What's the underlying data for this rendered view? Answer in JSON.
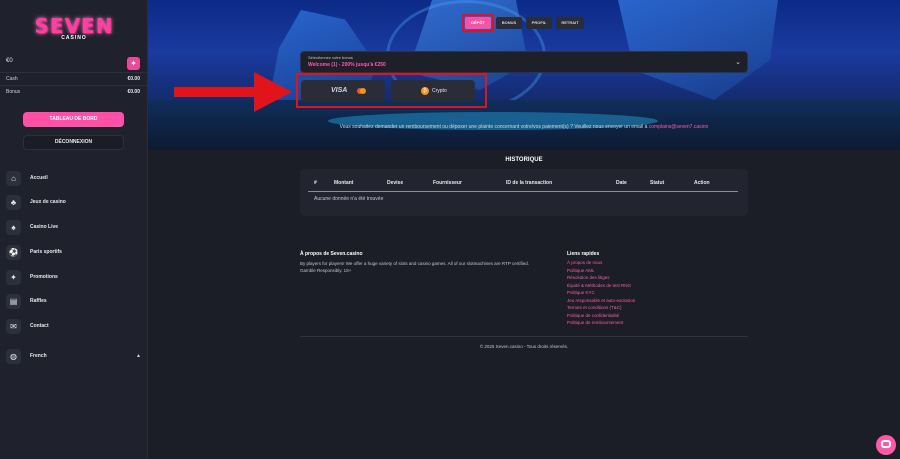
{
  "brand": {
    "logo_main": "SEVEN",
    "logo_sub": "CASINO"
  },
  "balance": {
    "amount": "€0",
    "gift_icon": "gift-icon"
  },
  "balances": [
    {
      "label": "Cash",
      "amount": "€0.00"
    },
    {
      "label": "Bonus",
      "amount": "€0.00"
    }
  ],
  "sidebar": {
    "dashboard_label": "TABLEAU DE BORD",
    "logout_label": "DÉCONNEXION",
    "nav": [
      {
        "label": "Accueil",
        "icon": "home-icon",
        "glyph": "⌂"
      },
      {
        "label": "Jeux de casino",
        "icon": "slots-icon",
        "glyph": "♣"
      },
      {
        "label": "Casino Live",
        "icon": "live-casino-icon",
        "glyph": "♠"
      },
      {
        "label": "Paris sportifs",
        "icon": "football-icon",
        "glyph": "⚽"
      },
      {
        "label": "Promotions",
        "icon": "megaphone-icon",
        "glyph": "✦"
      },
      {
        "label": "Raffles",
        "icon": "ticket-icon",
        "glyph": "▤"
      },
      {
        "label": "Contact",
        "icon": "mail-icon",
        "glyph": "✉"
      },
      {
        "label": "French",
        "icon": "globe-icon",
        "glyph": "◍"
      }
    ],
    "language_chevron": "▴"
  },
  "tabs": [
    {
      "label": "DÉPÔT",
      "active": true
    },
    {
      "label": "BONUS",
      "active": false
    },
    {
      "label": "PROFIL",
      "active": false
    },
    {
      "label": "RETRAIT",
      "active": false
    }
  ],
  "bonus_select": {
    "label": "Sélectionnez votre bonus",
    "value": "Welcome (1) - 200% jusqu'à €250",
    "chevron": "⌄"
  },
  "payment_methods": [
    {
      "label": "VISA",
      "icon": "visa-mastercard-icon"
    },
    {
      "label": "Crypto",
      "icon": "bitcoin-icon",
      "glyph": "₿"
    }
  ],
  "refund_note": {
    "text": "Vous souhaitez demander un remboursement ou déposer une plainte concernant votre/vos paiement(s) ? Veuillez nous envoyer un email à",
    "email": "complains@seven7.casino"
  },
  "history": {
    "title": "HISTORIQUE",
    "columns": [
      "#",
      "Montant",
      "Devise",
      "Fournisseur",
      "ID de la transaction",
      "Date",
      "Statut",
      "Action"
    ],
    "empty": "Aucune donnée n'a été trouvée"
  },
  "footer": {
    "about_title": "À propos de Seven.casino",
    "about_text": "By players for players! We offer a huge variety of slots and casino games. All of our slotmachines are RTP certified. Gamble Responsibly. 18+",
    "links_title": "Liens rapides",
    "links": [
      "À propos de nous",
      "Politique AML",
      "Résolution des litiges",
      "Équité & Méthodes de test RNG",
      "Politique KYC",
      "Jeu responsable et auto-exclusion",
      "Termes et conditions (T&C)",
      "Politique de confidentialité",
      "Politique de remboursement"
    ],
    "copyright": "© 2025 Seven.casino - Tous droits réservés."
  },
  "chat": {
    "icon": "chat-icon"
  },
  "colors": {
    "accent": "#ff4fa6",
    "annotation": "#e0141a",
    "sidebar_bg": "#1f222c",
    "page_bg": "#1b1e27"
  }
}
